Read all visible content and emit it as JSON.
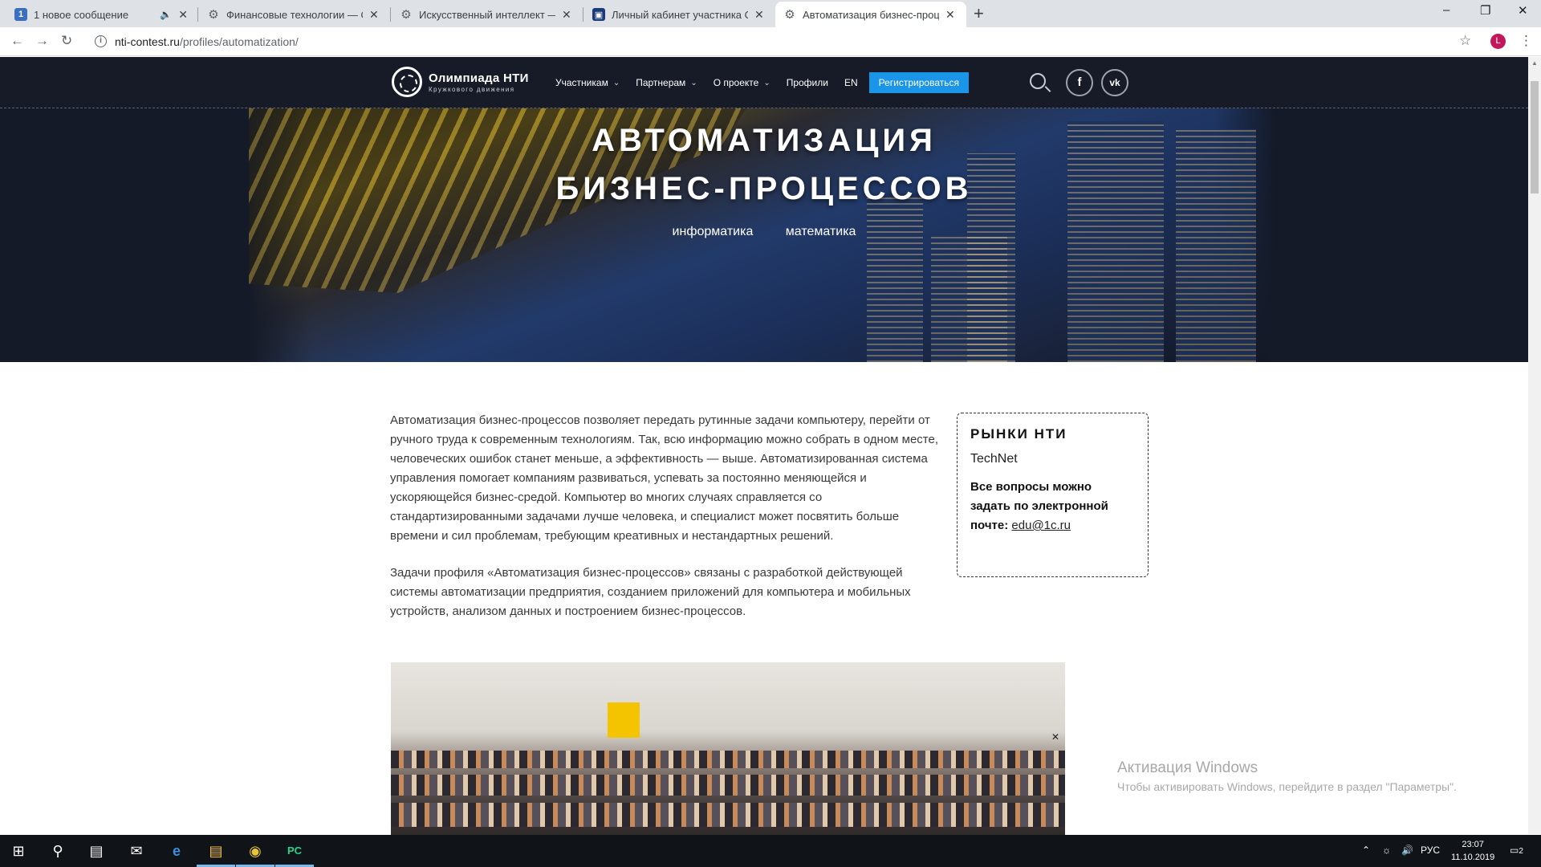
{
  "browser": {
    "tabs": [
      {
        "title": "1 новое сообщение",
        "favicon": "mail-icon"
      },
      {
        "title": "Финансовые технологии — Оли",
        "favicon": "site-gear-icon"
      },
      {
        "title": "Искусственный интеллект — Ол",
        "favicon": "site-gear-icon"
      },
      {
        "title": "Личный кабинет участника Оли",
        "favicon": "dashboard-icon"
      },
      {
        "title": "Автоматизация бизнес-процес",
        "favicon": "site-gear-icon"
      }
    ],
    "badge_count": "1",
    "active_tab_index": 4,
    "url_host": "nti-contest.ru",
    "url_path": "/profiles/automatization/",
    "profile_initial": "L"
  },
  "site": {
    "logo_title": "Олимпиада НТИ",
    "logo_subtitle": "Кружкового движения",
    "nav": {
      "participants": "Участникам",
      "partners": "Партнерам",
      "about": "О проекте",
      "profiles": "Профили",
      "lang": "EN",
      "register": "Регистрироваться"
    },
    "social": {
      "facebook": "f",
      "vk": "vk"
    }
  },
  "hero": {
    "title_line1": "АВТОМАТИЗАЦИЯ",
    "title_line2": "БИЗНЕС-ПРОЦЕССОВ",
    "tags": [
      "информатика",
      "математика"
    ]
  },
  "content": {
    "paragraph1": "Автоматизация бизнес-процессов позволяет передать рутинные задачи компьютеру, перейти от ручного труда к современным технологиям. Так, всю информацию можно собрать в одном месте, человеческих ошибок станет меньше, а эффективность — выше. Автоматизированная система управления помогает компаниям развиваться, успевать за постоянно меняющейся и ускоряющейся бизнес-средой. Компьютер во многих случаях справляется со стандартизированными задачами лучше человека, и специалист может посвятить больше времени и сил проблемам, требующим креативных и нестандартных решений.",
    "paragraph2": "Задачи профиля «Автоматизация бизнес-процессов» связаны с разработкой действующей системы автоматизации предприятия, созданием приложений для компьютера и мобильных устройств, анализом данных и построением бизнес-процессов."
  },
  "sidebox": {
    "title": "РЫНКИ НТИ",
    "market": "TechNet",
    "question": "Все вопросы можно задать по электронной почте:",
    "email": "edu@1c.ru"
  },
  "watermark": {
    "title": "Активация Windows",
    "subtitle": "Чтобы активировать Windows, перейдите в раздел \"Параметры\"."
  },
  "taskbar": {
    "lang": "РУС",
    "time": "23:07",
    "date": "11.10.2019",
    "notifications": "2"
  }
}
